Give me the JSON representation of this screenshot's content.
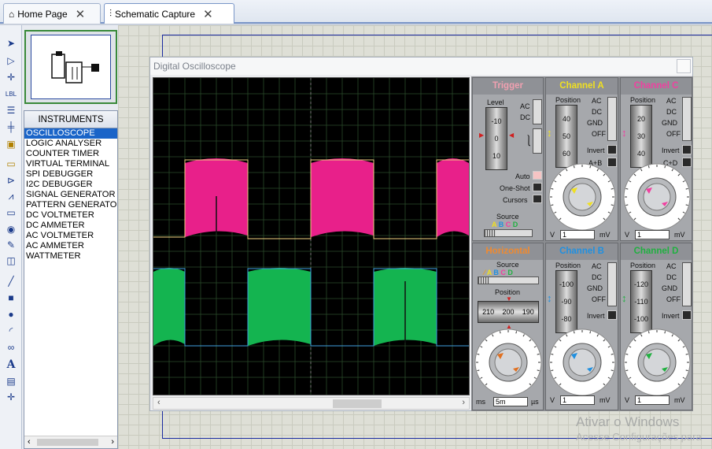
{
  "tabs": [
    {
      "label": "Home Page",
      "icon": "home-icon"
    },
    {
      "label": "Schematic Capture",
      "icon": "schematic-icon"
    }
  ],
  "toolbar": {
    "icons": [
      "selection-pointer-icon",
      "component-mode-icon",
      "junction-dot-icon",
      "wire-label-icon",
      "text-script-icon",
      "bus-icon",
      "subcircuit-icon",
      "terminals-icon",
      "device-pins-icon",
      "graph-icon",
      "tape-recorder-icon",
      "generator-icon",
      "voltage-probe-icon",
      "current-probe-icon",
      "virtual-instruments-icon",
      "line-icon",
      "box-icon",
      "circle-icon",
      "arc-icon",
      "path-icon",
      "text-icon",
      "symbol-icon",
      "marker-icon"
    ],
    "text_glyphs": {
      "wire_label": "LBL",
      "text": "A"
    }
  },
  "left_panel": {
    "header": "INSTRUMENTS",
    "items": [
      "OSCILLOSCOPE",
      "LOGIC ANALYSER",
      "COUNTER TIMER",
      "VIRTUAL TERMINAL",
      "SPI DEBUGGER",
      "I2C DEBUGGER",
      "SIGNAL GENERATOR",
      "PATTERN GENERATO",
      "DC VOLTMETER",
      "DC AMMETER",
      "AC VOLTMETER",
      "AC AMMETER",
      "WATTMETER"
    ],
    "selected_index": 0
  },
  "workspace": {
    "watermark_line1": "Ativar o Windows",
    "watermark_line2": "Acesse Configurações para"
  },
  "oscilloscope": {
    "title": "Digital Oscilloscope",
    "trigger": {
      "title": "Trigger",
      "title_color": "#f0a0b0",
      "level_label": "Level",
      "level_drum": [
        "-10",
        "0",
        "10"
      ],
      "coupling": [
        "AC",
        "DC"
      ],
      "modes": [
        "Auto",
        "One-Shot",
        "Cursors"
      ],
      "source_label": "Source",
      "source_letters": [
        "A",
        "B",
        "C",
        "D"
      ]
    },
    "horizontal": {
      "title": "Horizontal",
      "title_color": "#f08a30",
      "source_label": "Source",
      "source_letters": [
        "A",
        "B",
        "C",
        "D"
      ],
      "position_label": "Position",
      "position_drum": [
        "210",
        "200",
        "190"
      ],
      "dial_scale": [
        "0.5",
        "1",
        "2",
        "5",
        "10",
        "20",
        "50",
        "100",
        "200",
        "0.2",
        "0.1",
        "0.05",
        "0.02"
      ],
      "field_value": "5m",
      "unit_left": "ms",
      "unit_right": "µs"
    },
    "channels": [
      {
        "title": "Channel A",
        "color": "#f0e020",
        "position_label": "Position",
        "drum": [
          "40",
          "50",
          "60"
        ],
        "coupling": [
          "AC",
          "DC",
          "GND",
          "OFF"
        ],
        "invert": "Invert",
        "extra": "A+B",
        "field_value": "1",
        "unit_left": "V",
        "unit_right": "mV",
        "dial_scale": [
          "0.5",
          "0.2",
          "0.1",
          "0.05",
          "1",
          "2",
          "5",
          "10",
          "20",
          "2",
          "5",
          "10",
          "20",
          "50",
          "100",
          "200"
        ]
      },
      {
        "title": "Channel C",
        "color": "#f040a0",
        "position_label": "Position",
        "drum": [
          "20",
          "30",
          "40"
        ],
        "coupling": [
          "AC",
          "DC",
          "GND",
          "OFF"
        ],
        "invert": "Invert",
        "extra": "C+D",
        "field_value": "1",
        "unit_left": "V",
        "unit_right": "mV",
        "dial_scale": [
          "0.5",
          "0.2",
          "0.1",
          "0.05",
          "1",
          "2",
          "5",
          "10",
          "20",
          "2",
          "5",
          "10",
          "20",
          "50",
          "100",
          "200"
        ]
      },
      {
        "title": "Channel B",
        "color": "#2090e0",
        "position_label": "Position",
        "drum": [
          "-100",
          "-90",
          "-80"
        ],
        "coupling": [
          "AC",
          "DC",
          "GND",
          "OFF"
        ],
        "invert": "Invert",
        "extra": "",
        "field_value": "1",
        "unit_left": "V",
        "unit_right": "mV",
        "dial_scale": [
          "0.5",
          "0.2",
          "0.1",
          "0.05",
          "1",
          "2",
          "5",
          "10",
          "20",
          "2",
          "5",
          "10",
          "20",
          "50",
          "100",
          "200"
        ]
      },
      {
        "title": "Channel D",
        "color": "#20b040",
        "position_label": "Position",
        "drum": [
          "-120",
          "-110",
          "-100"
        ],
        "coupling": [
          "AC",
          "DC",
          "GND",
          "OFF"
        ],
        "invert": "Invert",
        "extra": "",
        "field_value": "1",
        "unit_left": "V",
        "unit_right": "mV",
        "dial_scale": [
          "0.5",
          "0.2",
          "0.1",
          "0.05",
          "1",
          "2",
          "5",
          "10",
          "20",
          "2",
          "5",
          "10",
          "20",
          "50",
          "100",
          "200"
        ]
      }
    ],
    "trace_colors": {
      "pink": "#e8208a",
      "green": "#14b450",
      "baseline_a": "#f0d080",
      "baseline_b": "#40a0e0"
    }
  }
}
